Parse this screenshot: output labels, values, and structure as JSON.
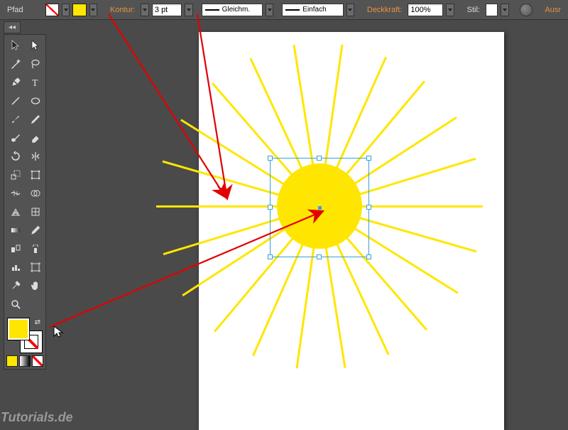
{
  "topbar": {
    "title": "Pfad",
    "kontur_label": "Kontur:",
    "stroke_weight": "3 pt",
    "stroke_profile": "Gleichm.",
    "stroke_type": "Einfach",
    "opacity_label": "Deckkraft:",
    "opacity_value": "100%",
    "style_label": "Stil:",
    "cutoff_label": "Ausr"
  },
  "colors": {
    "fill": "#ffe600",
    "stroke": "none",
    "accent_blue": "#3aa0d8"
  },
  "canvas": {
    "artwork": "sunburst",
    "circle_selected": true,
    "ray_count": 22
  },
  "watermark": "-Tutorials.de"
}
